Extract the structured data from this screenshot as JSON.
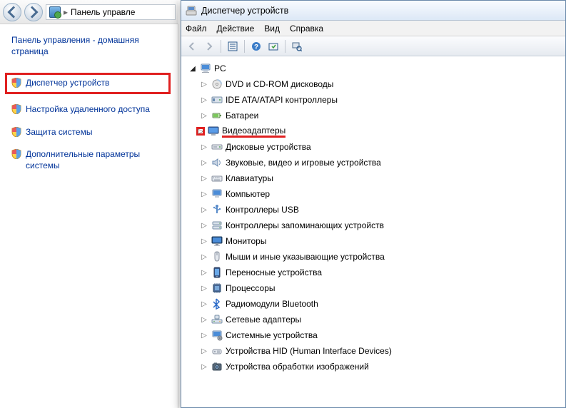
{
  "controlPanel": {
    "breadcrumb": "Панель управле",
    "homeTitle": "Панель управления - домашняя страница",
    "links": [
      {
        "label": "Диспетчер устройств",
        "hasShield": true,
        "highlighted": true
      },
      {
        "label": "Настройка удаленного доступа",
        "hasShield": true,
        "highlighted": false
      },
      {
        "label": "Защита системы",
        "hasShield": true,
        "highlighted": false
      },
      {
        "label": "Дополнительные параметры системы",
        "hasShield": true,
        "highlighted": false
      }
    ]
  },
  "deviceManager": {
    "title": "Диспетчер устройств",
    "menu": {
      "file": "Файл",
      "action": "Действие",
      "view": "Вид",
      "help": "Справка"
    },
    "tree": {
      "root": "PC",
      "items": [
        {
          "label": "DVD и CD-ROM дисководы",
          "icon": "disc"
        },
        {
          "label": "IDE ATA/ATAPI контроллеры",
          "icon": "ide"
        },
        {
          "label": "Батареи",
          "icon": "battery"
        },
        {
          "label": "Видеоадаптеры",
          "icon": "display",
          "highlighted": true
        },
        {
          "label": "Дисковые устройства",
          "icon": "drive"
        },
        {
          "label": "Звуковые, видео и игровые устройства",
          "icon": "sound"
        },
        {
          "label": "Клавиатуры",
          "icon": "keyboard"
        },
        {
          "label": "Компьютер",
          "icon": "computer"
        },
        {
          "label": "Контроллеры USB",
          "icon": "usb"
        },
        {
          "label": "Контроллеры запоминающих устройств",
          "icon": "storage"
        },
        {
          "label": "Мониторы",
          "icon": "monitor"
        },
        {
          "label": "Мыши и иные указывающие устройства",
          "icon": "mouse"
        },
        {
          "label": "Переносные устройства",
          "icon": "portable"
        },
        {
          "label": "Процессоры",
          "icon": "cpu"
        },
        {
          "label": "Радиомодули Bluetooth",
          "icon": "bluetooth"
        },
        {
          "label": "Сетевые адаптеры",
          "icon": "network"
        },
        {
          "label": "Системные устройства",
          "icon": "system"
        },
        {
          "label": "Устройства HID (Human Interface Devices)",
          "icon": "hid"
        },
        {
          "label": "Устройства обработки изображений",
          "icon": "imaging"
        }
      ]
    }
  }
}
